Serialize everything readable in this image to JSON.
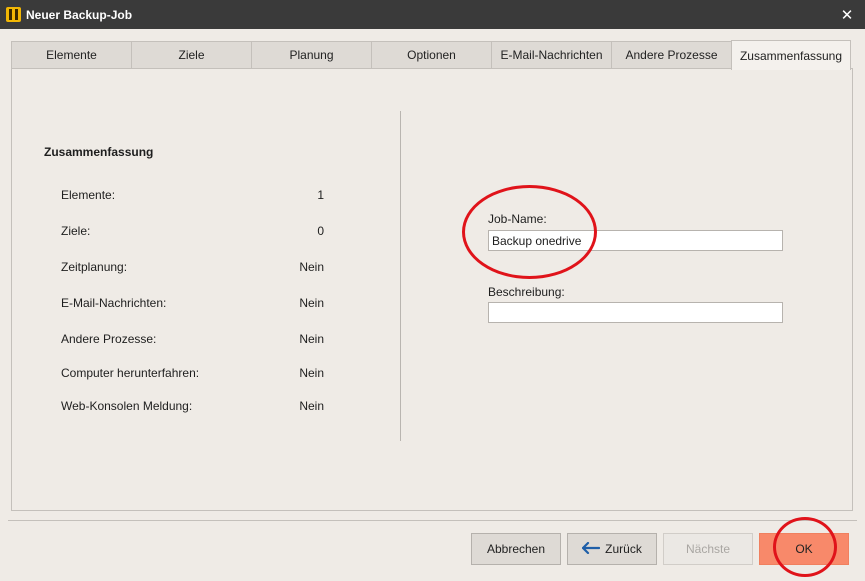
{
  "window": {
    "title": "Neuer Backup-Job",
    "close_glyph": "✕",
    "icon": "app-logo-icon"
  },
  "tabs": [
    {
      "label": "Elemente",
      "active": false
    },
    {
      "label": "Ziele",
      "active": false
    },
    {
      "label": "Planung",
      "active": false
    },
    {
      "label": "Optionen",
      "active": false
    },
    {
      "label": "E-Mail-Nachrichten",
      "active": false
    },
    {
      "label": "Andere Prozesse",
      "active": false
    },
    {
      "label": "Zusammenfassung",
      "active": true
    }
  ],
  "summary": {
    "title": "Zusammenfassung",
    "rows": [
      {
        "label": "Elemente:",
        "value": "1"
      },
      {
        "label": "Ziele:",
        "value": "0"
      },
      {
        "label": "Zeitplanung:",
        "value": "Nein"
      },
      {
        "label": "E-Mail-Nachrichten:",
        "value": "Nein"
      },
      {
        "label": "Andere Prozesse:",
        "value": "Nein"
      },
      {
        "label": "Computer herunterfahren:",
        "value": "Nein"
      },
      {
        "label": "Web-Konsolen Meldung:",
        "value": "Nein"
      }
    ]
  },
  "form": {
    "job_name_label": "Job-Name:",
    "job_name_value": "Backup onedrive",
    "description_label": "Beschreibung:",
    "description_value": ""
  },
  "buttons": {
    "cancel": "Abbrechen",
    "back": "Zurück",
    "back_icon": "arrow-left-icon",
    "next": "Nächste",
    "ok": "OK"
  },
  "colors": {
    "titlebar": "#3a3a3a",
    "ok_button": "#f8896a",
    "annotation": "#e0131a",
    "arrow": "#1f5fa8"
  }
}
